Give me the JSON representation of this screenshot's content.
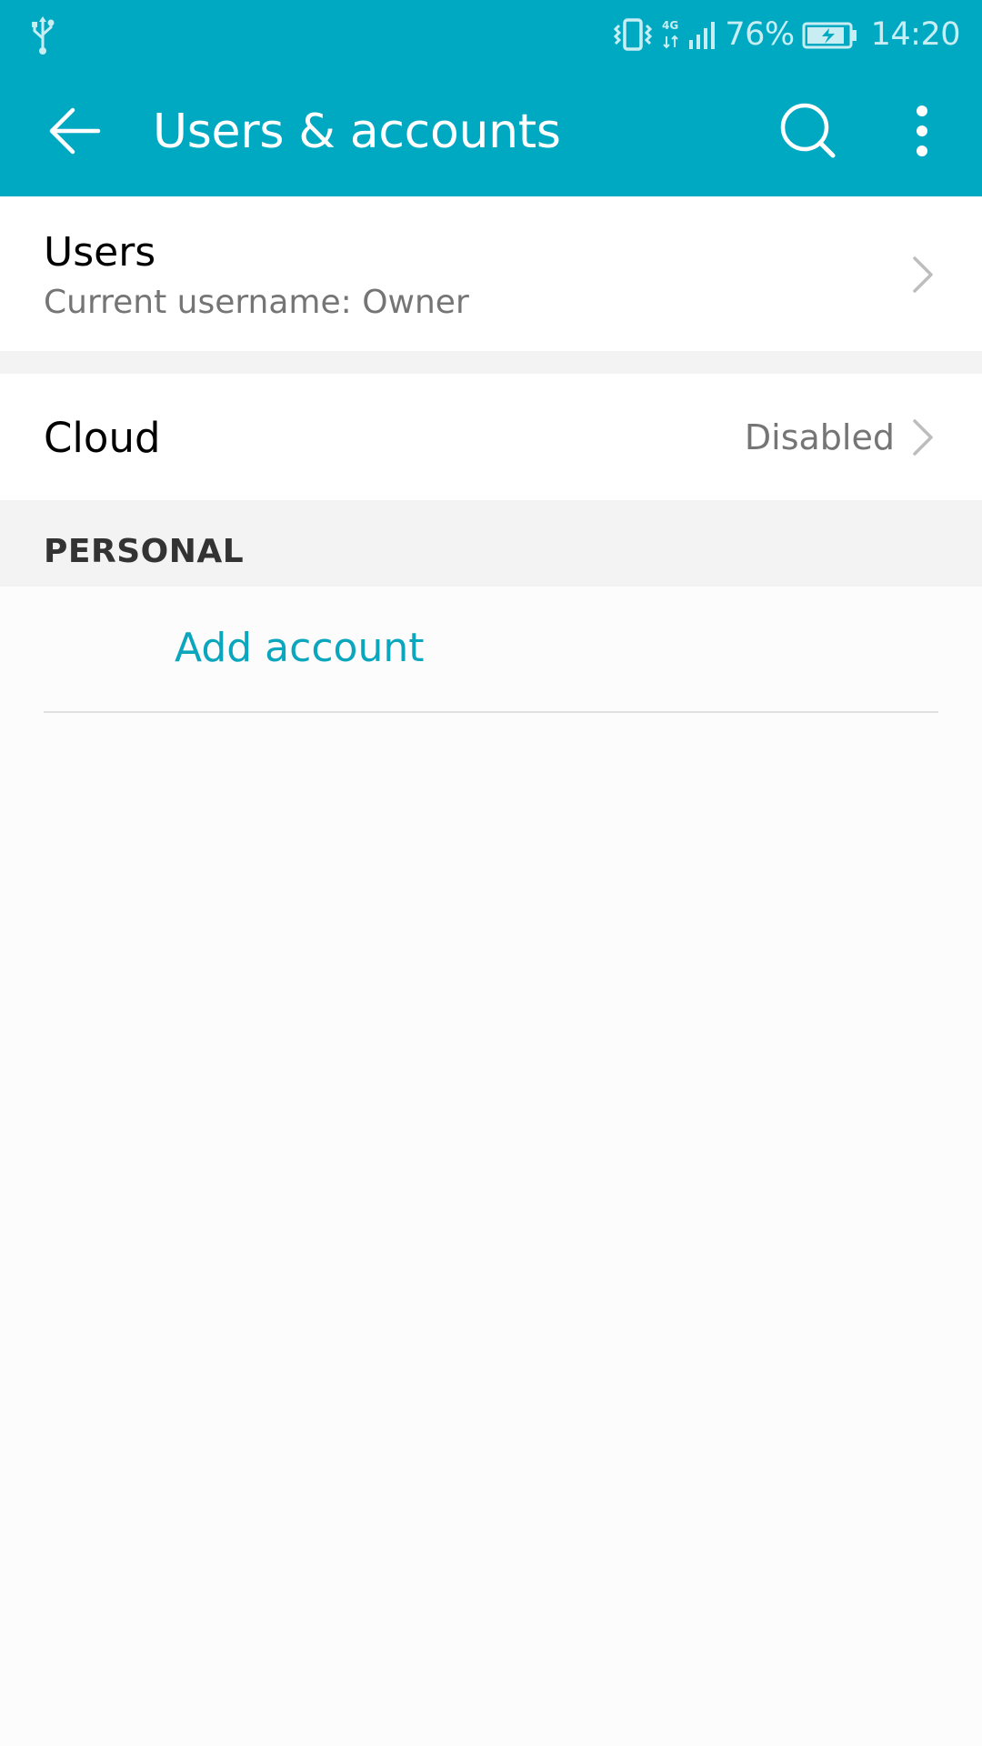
{
  "status_bar": {
    "battery_percent": "76%",
    "time": "14:20",
    "icons": [
      "usb-icon",
      "vibrate-icon",
      "4g-icon",
      "signal-icon",
      "battery-charging-icon"
    ]
  },
  "app_bar": {
    "title": "Users & accounts",
    "icons": [
      "back-arrow-icon",
      "search-icon",
      "more-vert-icon"
    ],
    "background_color": "#00a9c2"
  },
  "users_row": {
    "title": "Users",
    "subtitle": "Current username: Owner"
  },
  "cloud_row": {
    "title": "Cloud",
    "value": "Disabled"
  },
  "personal_section": {
    "header": "PERSONAL",
    "add_account_label": "Add account"
  },
  "colors": {
    "accent": "#0aa6bd",
    "secondary_text": "#757575",
    "section_bg": "#f3f3f3"
  }
}
